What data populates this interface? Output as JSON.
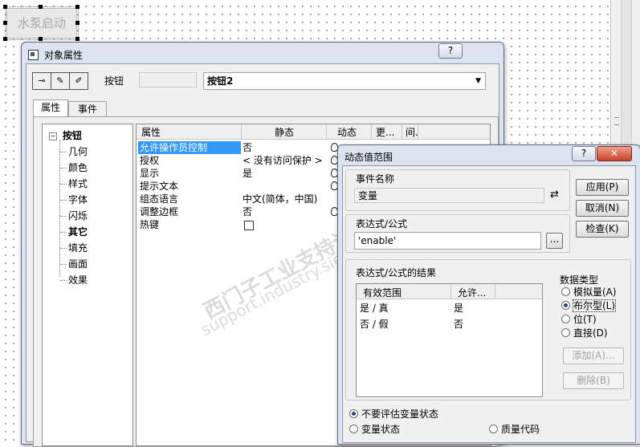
{
  "canvas": {
    "button_label": "水泵启动"
  },
  "props_dialog": {
    "title": "对象属性",
    "help_label": "?",
    "object_type": "按钮",
    "object_name": "按钮2",
    "tabs": [
      "属性",
      "事件"
    ],
    "tree": {
      "root": "按钮",
      "items": [
        "几何",
        "颜色",
        "样式",
        "字体",
        "闪烁",
        "其它",
        "填充",
        "画面",
        "效果"
      ]
    },
    "grid": {
      "headers": [
        "属性",
        "静态",
        "动态",
        "更...",
        "间."
      ],
      "rows": [
        {
          "prop": "允许操作员控制",
          "static": "否",
          "dyn": true
        },
        {
          "prop": "授权",
          "static": "< 没有访问保护 >",
          "dyn": true
        },
        {
          "prop": "显示",
          "static": "是",
          "dyn": true
        },
        {
          "prop": "提示文本",
          "static": "",
          "dyn": true
        },
        {
          "prop": "组态语言",
          "static": "中文(简体，中国)",
          "dyn": false
        },
        {
          "prop": "调整边框",
          "static": "否",
          "dyn": true
        },
        {
          "prop": "热键",
          "static": "",
          "dyn": false,
          "checkbox": true
        }
      ]
    }
  },
  "dyn_dialog": {
    "title": "动态值范围",
    "help_label": "?",
    "close_label": "✕",
    "event_name_label": "事件名称",
    "event_name_value": "变量",
    "expression_label": "表达式/公式",
    "expression_value": "'enable'",
    "browse_label": "...",
    "result_label": "表达式/公式的结果",
    "result_headers": [
      "有效范围",
      "允许..."
    ],
    "result_rows": [
      {
        "range": "是 / 真",
        "allow": "是"
      },
      {
        "range": "否 / 假",
        "allow": "否"
      }
    ],
    "buttons": {
      "apply": "应用(P)",
      "cancel": "取消(N)",
      "check": "检查(K)",
      "add": "添加(A)...",
      "delete": "删除(B)"
    },
    "datatype": {
      "label": "数据类型",
      "options": [
        "模拟量(A)",
        "布尔型(L)",
        "位(T)",
        "直接(D)"
      ],
      "selected": 1
    },
    "bottom_options": [
      "不要评估变量状态",
      "变量状态",
      "质量代码"
    ],
    "bottom_selected": 0
  },
  "watermark": {
    "line1": "西门子工业支持论坛",
    "line2": "support.industry.siemens.com/cs"
  }
}
